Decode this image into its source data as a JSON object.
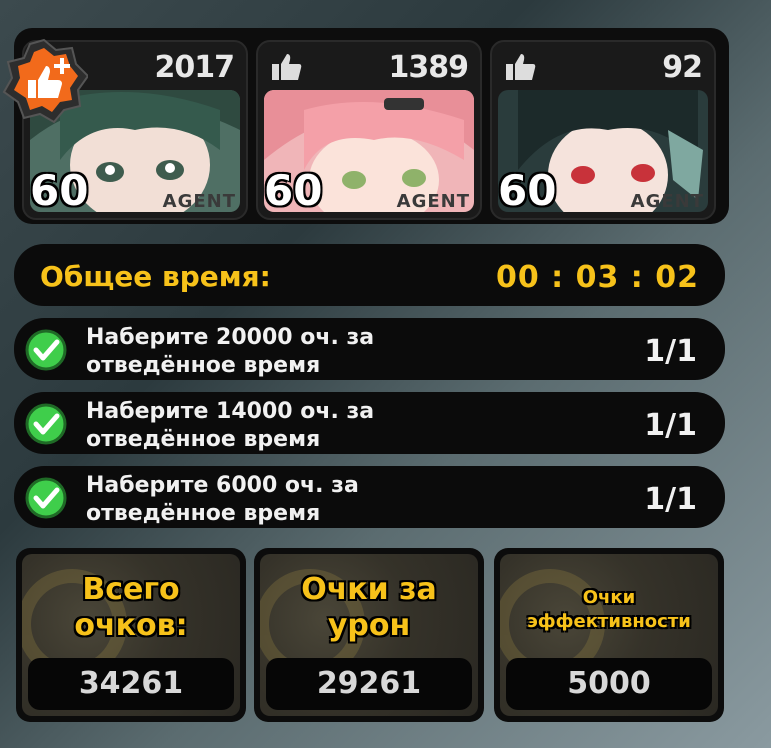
{
  "agents": [
    {
      "likes": "2017",
      "level": "60",
      "tag": "AGENT",
      "highlighted": true
    },
    {
      "likes": "1389",
      "level": "60",
      "tag": "AGENT",
      "highlighted": false
    },
    {
      "likes": "92",
      "level": "60",
      "tag": "AGENT",
      "highlighted": false
    }
  ],
  "timer": {
    "label": "Общее время:",
    "value": "00 : 03 : 02"
  },
  "tasks": [
    {
      "line1": "Наберите 20000 оч. за",
      "line2": "отведённое время",
      "count": "1/1"
    },
    {
      "line1": "Наберите 14000 оч. за",
      "line2": "отведённое время",
      "count": "1/1"
    },
    {
      "line1": "Наберите 6000 оч. за",
      "line2": "отведённое время",
      "count": "1/1"
    }
  ],
  "scores": [
    {
      "title_line1": "Всего",
      "title_line2": "очков:",
      "value": "34261"
    },
    {
      "title_line1": "Очки за",
      "title_line2": "урон",
      "value": "29261"
    },
    {
      "title_line1": "Очки",
      "title_line2": "эффективности",
      "value": "5000"
    }
  ],
  "colors": {
    "accent": "#f7c21a",
    "badge": "#f26a1b",
    "check": "#3fce4b"
  }
}
